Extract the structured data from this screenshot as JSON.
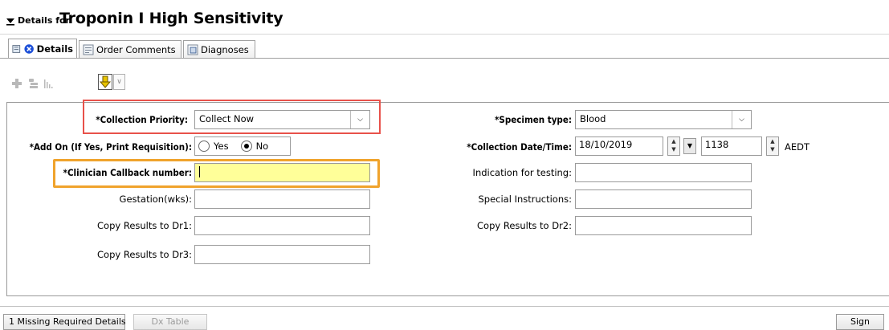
{
  "header": {
    "prefix": "Details for",
    "title": "Troponin I High Sensitivity"
  },
  "tabs": [
    {
      "label": "Details"
    },
    {
      "label": "Order Comments"
    },
    {
      "label": "Diagnoses"
    }
  ],
  "form": {
    "collection_priority": {
      "label": "*Collection Priority:",
      "value": "Collect Now"
    },
    "add_on": {
      "label": "*Add On (If Yes, Print Requisition):",
      "options": [
        "Yes",
        "No"
      ],
      "selected": "No"
    },
    "clinician_callback": {
      "label": "*Clinician Callback number:",
      "value": ""
    },
    "gestation": {
      "label": "Gestation(wks):",
      "value": ""
    },
    "copy_dr1": {
      "label": "Copy Results to Dr1:",
      "value": ""
    },
    "copy_dr3": {
      "label": "Copy Results to Dr3:",
      "value": ""
    },
    "specimen_type": {
      "label": "*Specimen type:",
      "value": "Blood"
    },
    "collection_datetime": {
      "label": "*Collection Date/Time:",
      "date": "18/10/2019",
      "time": "1138",
      "timezone": "AEDT"
    },
    "indication": {
      "label": "Indication for testing:",
      "value": ""
    },
    "special_instructions": {
      "label": "Special Instructions:",
      "value": ""
    },
    "copy_dr2": {
      "label": "Copy Results to Dr2:",
      "value": ""
    }
  },
  "footer": {
    "missing_label": "1 Missing Required Details",
    "dx_table_label": "Dx Table",
    "sign_label": "Sign"
  },
  "colors": {
    "highlight_red": "#e8514a",
    "highlight_orange": "#f0a32c",
    "required_field_bg": "#ffff99"
  }
}
